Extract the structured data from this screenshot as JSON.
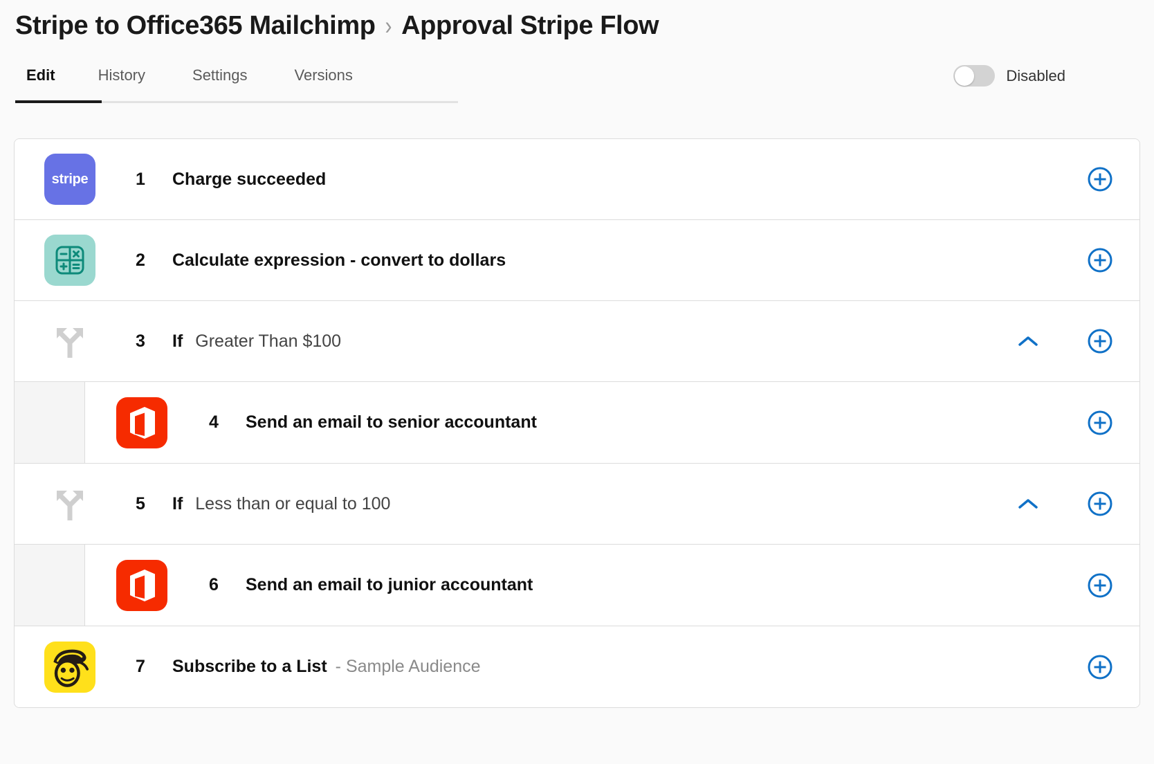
{
  "header": {
    "breadcrumb": {
      "parent": "Stripe to Office365 Mailchimp",
      "separator": "›",
      "current": "Approval Stripe Flow"
    },
    "tabs": [
      {
        "label": "Edit",
        "active": true
      },
      {
        "label": "History",
        "active": false
      },
      {
        "label": "Settings",
        "active": false
      },
      {
        "label": "Versions",
        "active": false
      }
    ],
    "toggle": {
      "label": "Disabled",
      "enabled": false
    }
  },
  "colors": {
    "accent_blue": "#1071c7",
    "stripe_purple": "#6772e5",
    "calculator_teal": "#9ad8cf",
    "calculator_teal_dark": "#0d8a7a",
    "office365_red": "#f62b00",
    "mailchimp_yellow": "#ffe01b",
    "muted_text": "#8a8a8a",
    "card_border": "#dcdcdc",
    "page_bg": "#fafafa"
  },
  "steps": [
    {
      "number": "1",
      "label": "Charge succeeded",
      "sub": "",
      "keyword": "",
      "icon": "stripe-icon",
      "nested": false,
      "collapsible": false,
      "add_label": "+"
    },
    {
      "number": "2",
      "label": "Calculate expression - convert to dollars",
      "sub": "",
      "keyword": "",
      "icon": "calculator-icon",
      "nested": false,
      "collapsible": false,
      "add_label": "+"
    },
    {
      "number": "3",
      "label": "",
      "sub": "Greater Than $100",
      "keyword": "If",
      "icon": "branch-icon",
      "nested": false,
      "collapsible": true,
      "add_label": "+"
    },
    {
      "number": "4",
      "label": "Send an email to senior accountant",
      "sub": "",
      "keyword": "",
      "icon": "office365-icon",
      "nested": true,
      "collapsible": false,
      "add_label": "+"
    },
    {
      "number": "5",
      "label": "",
      "sub": "Less than or equal to 100",
      "keyword": "If",
      "icon": "branch-icon",
      "nested": false,
      "collapsible": true,
      "add_label": "+"
    },
    {
      "number": "6",
      "label": "Send an email to junior accountant",
      "sub": "",
      "keyword": "",
      "icon": "office365-icon",
      "nested": true,
      "collapsible": false,
      "add_label": "+"
    },
    {
      "number": "7",
      "label": "Subscribe to a List",
      "sub": "- Sample Audience",
      "keyword": "",
      "icon": "mailchimp-icon",
      "nested": false,
      "collapsible": false,
      "add_label": "+"
    }
  ],
  "icon_labels": {
    "stripe": "stripe"
  }
}
